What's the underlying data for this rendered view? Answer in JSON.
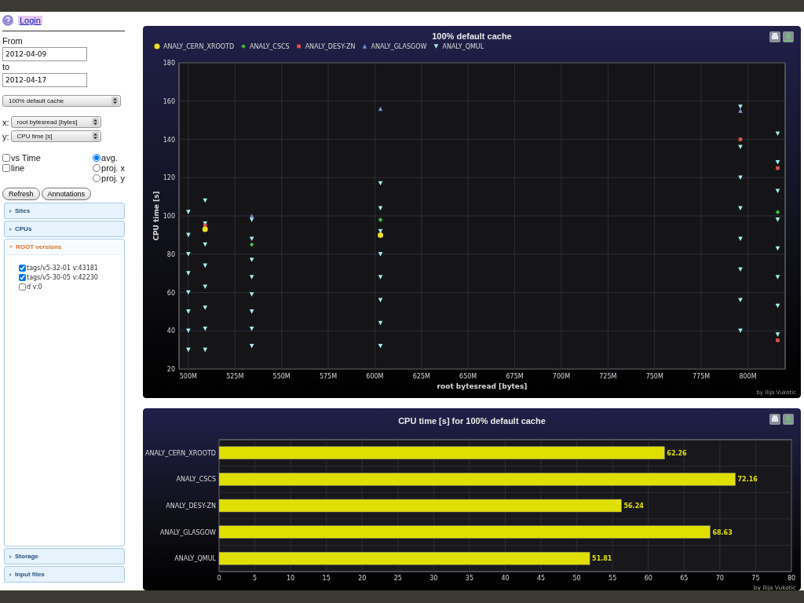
{
  "sidebar": {
    "login": "Login",
    "from_label": "From",
    "from_date": "2012-04-09",
    "to_label": "to",
    "to_date": "2012-04-17",
    "cache_select": "100% default cache",
    "x_label": "x:",
    "x_select": "root bytesread [bytes]",
    "y_label": "y:",
    "y_select": "CPU time [s]",
    "checkboxes": [
      {
        "label": "vs Time",
        "checked": false
      },
      {
        "label": "line",
        "checked": false
      }
    ],
    "radios": [
      {
        "label": "avg.",
        "selected": true
      },
      {
        "label": "proj. x",
        "selected": false
      },
      {
        "label": "proj. y",
        "selected": false
      }
    ],
    "buttons": [
      "Refresh",
      "Annotations"
    ],
    "sections": [
      {
        "title": "Sites",
        "expanded": false
      },
      {
        "title": "CPUs",
        "expanded": false
      },
      {
        "title": "ROOT versions",
        "expanded": true,
        "items": [
          {
            "label": "tags/v5-32-01 v:43181",
            "checked": true
          },
          {
            "label": "tags/v5-30-05 v:42230",
            "checked": true
          },
          {
            "label": "d v:0",
            "checked": false
          }
        ]
      },
      {
        "title": "Storage",
        "expanded": false
      },
      {
        "title": "Input files",
        "expanded": false
      }
    ]
  },
  "scatter": {
    "credit": "by Ilija Vukotic",
    "chart_data": {
      "type": "scatter",
      "title": "100% default cache",
      "xlabel": "root bytesread [bytes]",
      "ylabel": "CPU time [s]",
      "x": [
        500,
        500,
        500,
        500,
        500,
        500,
        500,
        500,
        509,
        509,
        509,
        509,
        509,
        509,
        509,
        509,
        534,
        534,
        534,
        534,
        534,
        534,
        534,
        534,
        603,
        603,
        603,
        603,
        603,
        603,
        603,
        603,
        796,
        796,
        796,
        796,
        796,
        796,
        796,
        796,
        816,
        816,
        816,
        816,
        816,
        816,
        816,
        816
      ],
      "xlim": [
        495,
        820
      ],
      "ylim": [
        20,
        180
      ],
      "xticks": [
        {
          "value": 500,
          "label": "500M"
        },
        {
          "value": 525,
          "label": "525M"
        },
        {
          "value": 550,
          "label": "550M"
        },
        {
          "value": 575,
          "label": "575M"
        },
        {
          "value": 600,
          "label": "600M"
        },
        {
          "value": 625,
          "label": "625M"
        },
        {
          "value": 650,
          "label": "650M"
        },
        {
          "value": 675,
          "label": "675M"
        },
        {
          "value": 700,
          "label": "700M"
        },
        {
          "value": 725,
          "label": "725M"
        },
        {
          "value": 750,
          "label": "750M"
        },
        {
          "value": 775,
          "label": "775M"
        },
        {
          "value": 800,
          "label": "800M"
        }
      ],
      "yticks": [
        20,
        40,
        60,
        80,
        100,
        120,
        140,
        160,
        180
      ],
      "grid": true,
      "legend": "top-left",
      "series": [
        {
          "name": "ANALY_CERN_XROOTD",
          "color": "#f0e020",
          "values": [
            null,
            null,
            null,
            null,
            null,
            null,
            null,
            null,
            93,
            null,
            null,
            null,
            null,
            null,
            null,
            null,
            null,
            null,
            null,
            null,
            null,
            null,
            null,
            null,
            null,
            90,
            null,
            null,
            null,
            null,
            null,
            null,
            null,
            null,
            null,
            null,
            null,
            null,
            null,
            null,
            null,
            null,
            null,
            null,
            null,
            null,
            null,
            null
          ]
        },
        {
          "name": "ANALY_CSCS",
          "color": "#40c040",
          "values": [
            null,
            null,
            null,
            null,
            null,
            null,
            null,
            null,
            null,
            null,
            null,
            null,
            null,
            null,
            null,
            null,
            85,
            null,
            null,
            null,
            null,
            null,
            null,
            null,
            98,
            null,
            null,
            null,
            null,
            null,
            null,
            null,
            null,
            null,
            null,
            null,
            null,
            null,
            null,
            null,
            102,
            null,
            null,
            null,
            null,
            null,
            null,
            null
          ]
        },
        {
          "name": "ANALY_DESY-ZN",
          "color": "#e05050",
          "values": [
            null,
            null,
            null,
            null,
            null,
            null,
            null,
            null,
            95,
            null,
            null,
            null,
            null,
            null,
            null,
            null,
            null,
            null,
            null,
            null,
            null,
            null,
            null,
            null,
            null,
            null,
            null,
            null,
            null,
            null,
            null,
            null,
            140,
            null,
            null,
            null,
            null,
            null,
            null,
            null,
            125,
            35,
            null,
            null,
            null,
            null,
            null,
            null
          ]
        },
        {
          "name": "ANALY_GLASGOW",
          "color": "#7090c8",
          "values": [
            null,
            null,
            null,
            null,
            null,
            null,
            null,
            null,
            null,
            null,
            null,
            null,
            null,
            null,
            null,
            null,
            100,
            null,
            null,
            null,
            null,
            null,
            null,
            null,
            156,
            null,
            null,
            null,
            null,
            null,
            null,
            null,
            155,
            null,
            null,
            null,
            null,
            null,
            null,
            null,
            null,
            null,
            null,
            null,
            null,
            null,
            null,
            null
          ]
        },
        {
          "name": "ANALY_QMUL",
          "color": "#a0f0f0",
          "values": [
            30,
            40,
            50,
            60,
            70,
            80,
            90,
            102,
            30,
            41,
            52,
            63,
            74,
            85,
            96,
            108,
            32,
            41,
            50,
            59,
            68,
            77,
            88,
            98,
            32,
            44,
            56,
            68,
            80,
            92,
            104,
            117,
            40,
            56,
            72,
            88,
            104,
            120,
            136,
            157,
            38,
            53,
            68,
            83,
            98,
            113,
            128,
            143
          ]
        }
      ]
    }
  },
  "bars": {
    "credit": "by Ilija Vukotic",
    "chart_data": {
      "type": "bar",
      "orientation": "horizontal",
      "title": "CPU time [s] for 100% default cache",
      "categories": [
        "ANALY_CERN_XROOTD",
        "ANALY_CSCS",
        "ANALY_DESY-ZN",
        "ANALY_GLASGOW",
        "ANALY_QMUL"
      ],
      "grid": true,
      "series": [
        {
          "color": "#e0e000",
          "values": [
            62.26,
            72.16,
            56.24,
            68.63,
            51.81
          ]
        }
      ],
      "value_labels": [
        "62.26",
        "72.16",
        "56.24",
        "68.63",
        "51.81"
      ],
      "xlim": [
        0,
        80
      ],
      "xticks": [
        0,
        5,
        10,
        15,
        20,
        25,
        30,
        35,
        40,
        45,
        50,
        55,
        60,
        65,
        70,
        75,
        80
      ],
      "data_labels": true
    }
  }
}
